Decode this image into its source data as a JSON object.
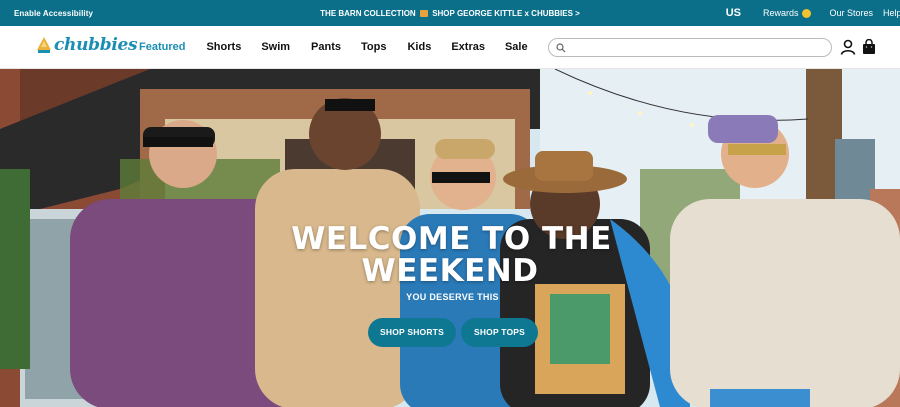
{
  "topbar": {
    "accessibility": "Enable Accessibility",
    "promo_left": "THE BARN COLLECTION",
    "promo_right": "SHOP GEORGE KITTLE x CHUBBIES >",
    "region": "US",
    "rewards": "Rewards",
    "stores": "Our Stores",
    "help": "Help"
  },
  "nav": {
    "logo": "chubbies",
    "items": [
      "Featured",
      "Shorts",
      "Swim",
      "Pants",
      "Tops",
      "Kids",
      "Extras",
      "Sale"
    ],
    "active": "Featured",
    "search_placeholder": ""
  },
  "hero": {
    "headline_line1": "WELCOME TO THE",
    "headline_line2": "WEEKEND",
    "subline": "YOU DESERVE THIS",
    "cta_shorts": "SHOP SHORTS",
    "cta_tops": "SHOP TOPS"
  },
  "colors": {
    "topbar": "#0b6f8a",
    "brand": "#1b8fb3",
    "cta": "#0e7892"
  }
}
